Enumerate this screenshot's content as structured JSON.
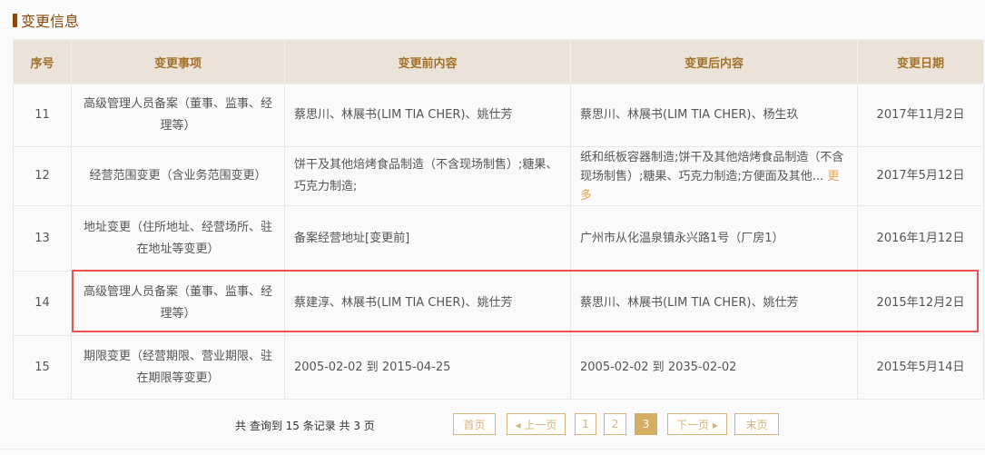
{
  "section_title": "变更信息",
  "headers": [
    "序号",
    "变更事项",
    "变更前内容",
    "变更后内容",
    "变更日期"
  ],
  "rows": [
    {
      "no": "11",
      "item": "高级管理人员备案（董事、监事、经理等）",
      "before": "蔡思川、林展书(LIM TIA CHER)、姚仕芳",
      "after": "蔡思川、林展书(LIM TIA CHER)、杨生玖",
      "date": "2017年11月2日"
    },
    {
      "no": "12",
      "item": "经营范围变更（含业务范围变更）",
      "before": "饼干及其他焙烤食品制造（不含现场制售）;糖果、巧克力制造;",
      "after": "纸和纸板容器制造;饼干及其他焙烤食品制造（不含现场制售）;糖果、巧克力制造;方便面及其他...",
      "after_more": "更多",
      "date": "2017年5月12日"
    },
    {
      "no": "13",
      "item": "地址变更（住所地址、经营场所、驻在地址等变更）",
      "before": "备案经营地址[变更前]",
      "after": "广州市从化温泉镇永兴路1号（厂房1）",
      "date": "2016年1月12日"
    },
    {
      "no": "14",
      "item": "高级管理人员备案（董事、监事、经理等）",
      "before": "蔡建淳、林展书(LIM TIA CHER)、姚仕芳",
      "after": "蔡思川、林展书(LIM TIA CHER)、姚仕芳",
      "date": "2015年12月2日"
    },
    {
      "no": "15",
      "item": "期限变更（经营期限、营业期限、驻在期限等变更）",
      "before": "2005-02-02 到 2015-04-25",
      "after": "2005-02-02 到 2035-02-02",
      "date": "2015年5月14日"
    }
  ],
  "pagination": {
    "info": "共 查询到 15 条记录 共 3 页",
    "first": "首页",
    "prev": "◂ 上一页",
    "pages": [
      "1",
      "2",
      "3"
    ],
    "current": "3",
    "next": "下一页 ▸",
    "last": "末页"
  }
}
